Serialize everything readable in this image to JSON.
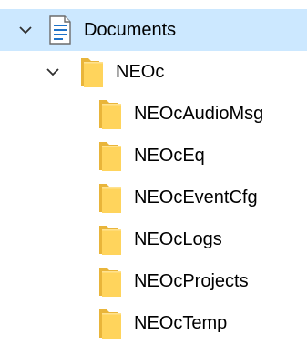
{
  "tree": {
    "root": {
      "label": "Documents",
      "icon": "documents-folder-icon",
      "expanded": true,
      "selected": true
    },
    "folder": {
      "label": "NEOc",
      "icon": "folder-icon",
      "expanded": true
    },
    "children": [
      {
        "label": "NEOcAudioMsg",
        "icon": "folder-icon"
      },
      {
        "label": "NEOcEq",
        "icon": "folder-icon"
      },
      {
        "label": "NEOcEventCfg",
        "icon": "folder-icon"
      },
      {
        "label": "NEOcLogs",
        "icon": "folder-icon"
      },
      {
        "label": "NEOcProjects",
        "icon": "folder-icon"
      },
      {
        "label": "NEOcTemp",
        "icon": "folder-icon"
      }
    ]
  },
  "colors": {
    "selection": "#cce8ff",
    "folder_front": "#ffd45c",
    "folder_back": "#e9b53a",
    "chevron": "#303030"
  }
}
